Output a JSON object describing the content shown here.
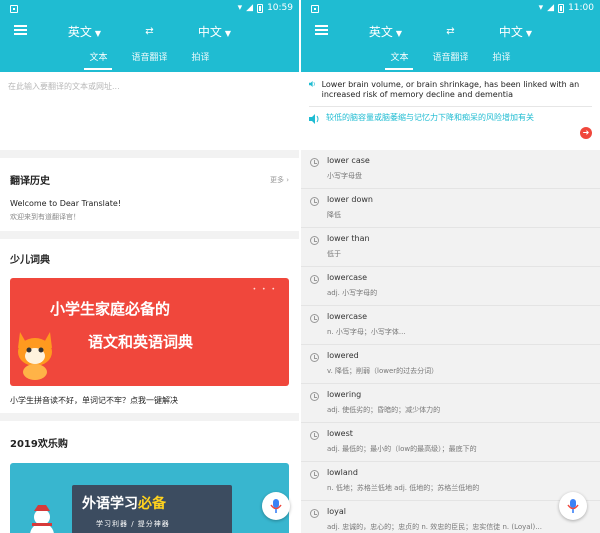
{
  "left": {
    "status": {
      "time": "10:59"
    },
    "lang_from": "英文",
    "lang_to": "中文",
    "tabs": [
      "文本",
      "语音翻译",
      "拍译"
    ],
    "input_placeholder": "在此输入要翻译的文本或网址...",
    "history": {
      "title": "翻译历史",
      "more": "更多 ›",
      "entry_en": "Welcome to Dear Translate!",
      "entry_zh": "欢迎来到有道翻译官！"
    },
    "dict": {
      "title": "少儿词典",
      "banner_line1": "小学生家庭必备的",
      "banner_line2": "语文和英语词典",
      "caption": "小学生拼音读不好，单词记不牢？点我一键解决"
    },
    "promo": {
      "title": "2019欢乐购",
      "banner_main": "外语学习",
      "banner_highlight": "必备",
      "banner_sub": "学习利器 / 提分神器"
    }
  },
  "right": {
    "status": {
      "time": "11:00"
    },
    "lang_from": "英文",
    "lang_to": "中文",
    "tabs": [
      "文本",
      "语音翻译",
      "拍译"
    ],
    "result_en": "Lower brain volume, or brain shrinkage, has been linked with an increased risk of memory decline and dementia",
    "result_zh": "较低的脑容量或脑萎缩与记忆力下降和痴呆的风险增加有关",
    "suggestions": [
      {
        "word": "lower case",
        "def": "小写字母盘"
      },
      {
        "word": "lower down",
        "def": "降低"
      },
      {
        "word": "lower than",
        "def": "低于"
      },
      {
        "word": "lowercase",
        "def": "adj. 小写字母的"
      },
      {
        "word": "lowercase",
        "def": "n. 小写字母；小写字体..."
      },
      {
        "word": "lowered",
        "def": "v. 降低；削弱（lower的过去分词）"
      },
      {
        "word": "lowering",
        "def": "adj. 使低劣的；昏暗的；减少体力的"
      },
      {
        "word": "lowest",
        "def": "adj. 最低的；最小的（low的最高级）；最底下的"
      },
      {
        "word": "lowland",
        "def": "n. 低地；苏格兰低地 adj. 低地的；苏格兰低地的"
      },
      {
        "word": "loyal",
        "def": "adj. 忠诚的，忠心的；忠贞的 n. 效忠的臣民；忠实信徒 n. (Loyal)..."
      }
    ]
  }
}
